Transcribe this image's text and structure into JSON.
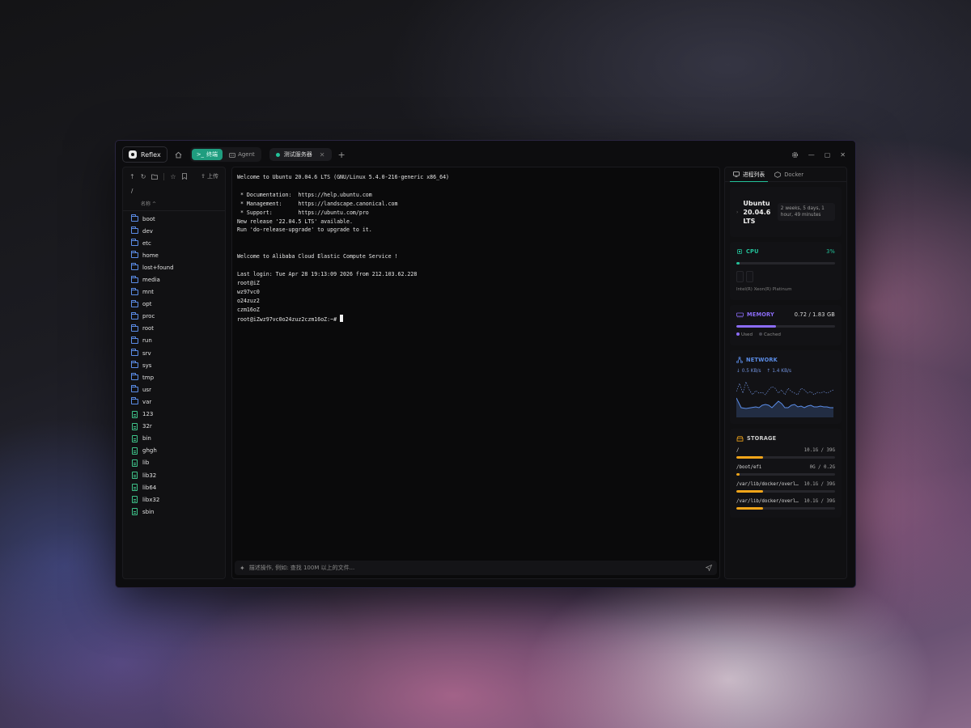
{
  "app": {
    "name": "Reflex"
  },
  "modes": {
    "terminal": "终端",
    "agent": "Agent"
  },
  "tab": {
    "label": "测试服务器"
  },
  "files": {
    "upload_label": "上传",
    "path": "/",
    "column_name": "名称",
    "items": [
      {
        "name": "boot",
        "type": "folder"
      },
      {
        "name": "dev",
        "type": "folder"
      },
      {
        "name": "etc",
        "type": "folder"
      },
      {
        "name": "home",
        "type": "folder"
      },
      {
        "name": "lost+found",
        "type": "folder"
      },
      {
        "name": "media",
        "type": "folder"
      },
      {
        "name": "mnt",
        "type": "folder"
      },
      {
        "name": "opt",
        "type": "folder"
      },
      {
        "name": "proc",
        "type": "folder"
      },
      {
        "name": "root",
        "type": "folder"
      },
      {
        "name": "run",
        "type": "folder"
      },
      {
        "name": "srv",
        "type": "folder"
      },
      {
        "name": "sys",
        "type": "folder"
      },
      {
        "name": "tmp",
        "type": "folder"
      },
      {
        "name": "usr",
        "type": "folder"
      },
      {
        "name": "var",
        "type": "folder"
      },
      {
        "name": "123",
        "type": "file"
      },
      {
        "name": "32r",
        "type": "file"
      },
      {
        "name": "bin",
        "type": "file"
      },
      {
        "name": "ghgh",
        "type": "file"
      },
      {
        "name": "lib",
        "type": "file"
      },
      {
        "name": "lib32",
        "type": "file"
      },
      {
        "name": "lib64",
        "type": "file"
      },
      {
        "name": "libx32",
        "type": "file"
      },
      {
        "name": "sbin",
        "type": "file"
      }
    ]
  },
  "terminal": {
    "lines": [
      "Welcome to Ubuntu 20.04.6 LTS (GNU/Linux 5.4.0-216-generic x86_64)",
      "",
      " * Documentation:  https://help.ubuntu.com",
      " * Management:     https://landscape.canonical.com",
      " * Support:        https://ubuntu.com/pro",
      "New release '22.04.5 LTS' available.",
      "Run 'do-release-upgrade' to upgrade to it.",
      "",
      "",
      "Welcome to Alibaba Cloud Elastic Compute Service !",
      "",
      "Last login: Tue Apr 28 19:13:09 2026 from 212.103.62.228",
      "root@iZ",
      "wz97vc0",
      "o24zuz2",
      "czm16oZ"
    ],
    "prompt_line": "root@iZwz97vc0o24zuz2czm16oZ:~# ",
    "ai_placeholder": "描述操作, 例如: 查找 100M 以上的文件..."
  },
  "panel": {
    "tabs": {
      "process": "进程列表",
      "docker": "Docker"
    },
    "os": {
      "name": "Ubuntu 20.04.6 LTS",
      "uptime": "2 weeks, 5 days, 1 hour, 49 minutes"
    },
    "cpu": {
      "label": "CPU",
      "value": "3%",
      "percent": 3,
      "model": "Intel(R) Xeon(R) Platinum",
      "color": "#23c29a"
    },
    "memory": {
      "label": "MEMORY",
      "value": "0.72 / 1.83 GB",
      "used_fraction": 0.4,
      "legend_used": "Used",
      "legend_cached": "Cached",
      "color": "#8b6cf6"
    },
    "network": {
      "label": "NETWORK",
      "down": "↓ 0.5 KB/s",
      "up": "↑ 1.4 KB/s",
      "color": "#5b8de8"
    },
    "storage": {
      "label": "STORAGE",
      "color": "#f2a51a",
      "mounts": [
        {
          "path": "/",
          "size": "10.1G / 39G",
          "fraction": 0.27
        },
        {
          "path": "/boot/efi",
          "size": "0G / 0.2G",
          "fraction": 0.03
        },
        {
          "path": "/var/lib/docker/overl…",
          "size": "10.1G / 39G",
          "fraction": 0.27
        },
        {
          "path": "/var/lib/docker/overl…",
          "size": "10.1G / 39G",
          "fraction": 0.27
        }
      ]
    }
  }
}
